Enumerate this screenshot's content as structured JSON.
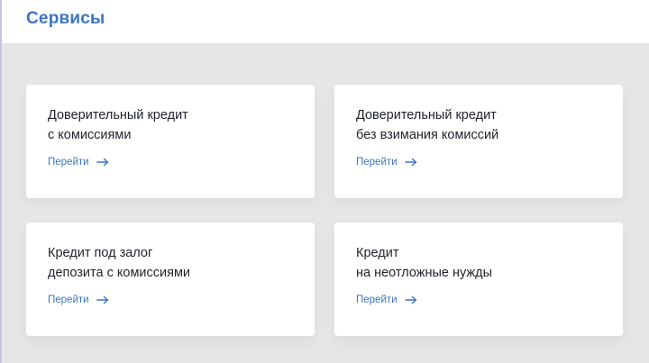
{
  "header": {
    "title": "Сервисы"
  },
  "services": [
    {
      "line1": "Доверительный кредит",
      "line2": "с комиссиями",
      "link": "Перейти"
    },
    {
      "line1": "Доверительный кредит",
      "line2": "без взимания комиссий",
      "link": "Перейти"
    },
    {
      "line1": "Кредит под залог",
      "line2": "депозита с комиссиями",
      "link": "Перейти"
    },
    {
      "line1": "Кредит",
      "line2": "на неотложные нужды",
      "link": "Перейти"
    }
  ],
  "colors": {
    "accent": "#3b74c4",
    "background": "#e6e6e8",
    "card": "#ffffff",
    "text": "#1f2328"
  },
  "icons": {
    "link_arrow": "arrow-right-icon"
  }
}
